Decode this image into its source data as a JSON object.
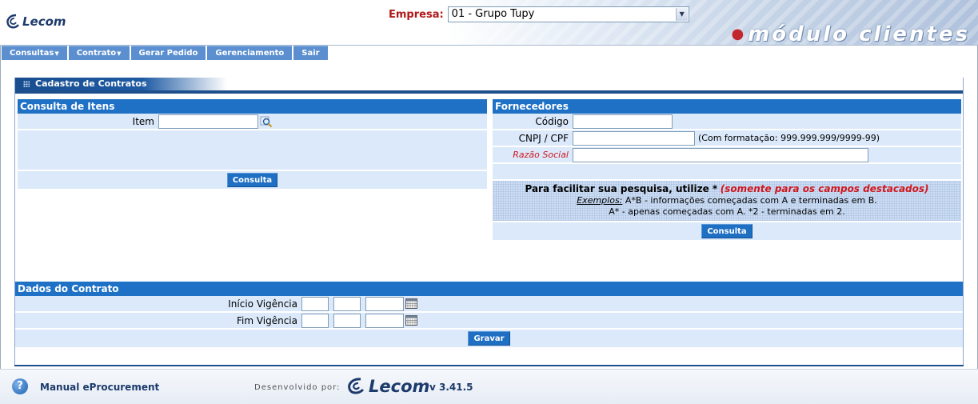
{
  "header": {
    "logo_text": "Lecom",
    "empresa_label": "Empresa:",
    "empresa_value": "01 - Grupo Tupy",
    "module_title": "módulo clientes"
  },
  "menu": [
    "Consultas",
    "Contrato",
    "Gerar Pedido",
    "Gerenciamento",
    "Sair"
  ],
  "page": {
    "title": "Cadastro de Contratos"
  },
  "consulta_itens": {
    "title": "Consulta de Itens",
    "item_label": "Item",
    "item_value": "",
    "button": "Consulta"
  },
  "fornecedores": {
    "title": "Fornecedores",
    "codigo_label": "Código",
    "cnpj_label": "CNPJ / CPF",
    "cnpj_hint": "(Com formatação: 999.999.999/9999-99)",
    "razao_label": "Razão Social",
    "hint_line1": "Para facilitar sua pesquisa, utilize *",
    "hint_line1_red": "(somente para os campos destacados)",
    "hint_examples_label": "Exemplos:",
    "hint_line2": "A*B - informações começadas com A e terminadas em B.",
    "hint_line3": "A* - apenas começadas com A. *2 - terminadas em 2.",
    "button": "Consulta"
  },
  "dados_contrato": {
    "title": "Dados do Contrato",
    "inicio_label": "Início Vigência",
    "fim_label": "Fim Vigência",
    "button": "Gravar"
  },
  "footer": {
    "manual": "Manual eProcurement",
    "dev_label": "Desenvolvido por:",
    "logo_text": "Lecom",
    "version": "v 3.41.5"
  },
  "colors": {
    "header_blue": "#1f71c6",
    "title_blue": "#1c4f8c",
    "row_bg": "#dbe9fb",
    "red_accent": "#d0161c"
  }
}
